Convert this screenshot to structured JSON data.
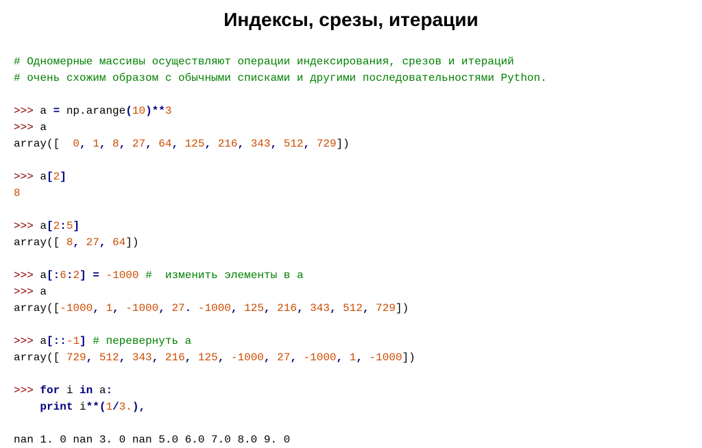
{
  "title": "Индексы, срезы, итерации",
  "cmt1": "# Одномерные массивы осуществляют операции индексирования, срезов и итераций",
  "cmt2": "# очень схожим образом с обычными списками и другими последовательностями Python.",
  "p": ">>> ",
  "eq": " = ",
  "arange": "np.arange",
  "lp": "(",
  "rp": ")",
  "lb": "[",
  "rb": "]",
  "star2": "**",
  "dot": ".",
  "cm": ", ",
  "cl": ":",
  "n0": "0",
  "n1": "1",
  "n2": "2",
  "n3": "3",
  "n5": "5",
  "n6": "6",
  "n8": "8",
  "n10": "10",
  "n27": "27",
  "n64": "64",
  "n125": "125",
  "n216": "216",
  "n343": "343",
  "n512": "512",
  "n729": "729",
  "nNeg1": "-1",
  "nNeg1000": "-1000",
  "a": "a",
  "array_open": "array([",
  "array_open_sp": "array([  ",
  "array_open_sp1": "array([ ",
  "array_close": "])",
  "res_a2": "8",
  "cmt_mod": " #  изменить элементы в a",
  "cmt_rev": " # перевернуть a",
  "for": "for",
  "in": "in",
  "print": "print",
  "i": "i",
  "f1": "1",
  "f3": "3.",
  "res_final": "nan 1. 0 nan 3. 0 nan 5.0 6.0 7.0 8.0 9. 0"
}
